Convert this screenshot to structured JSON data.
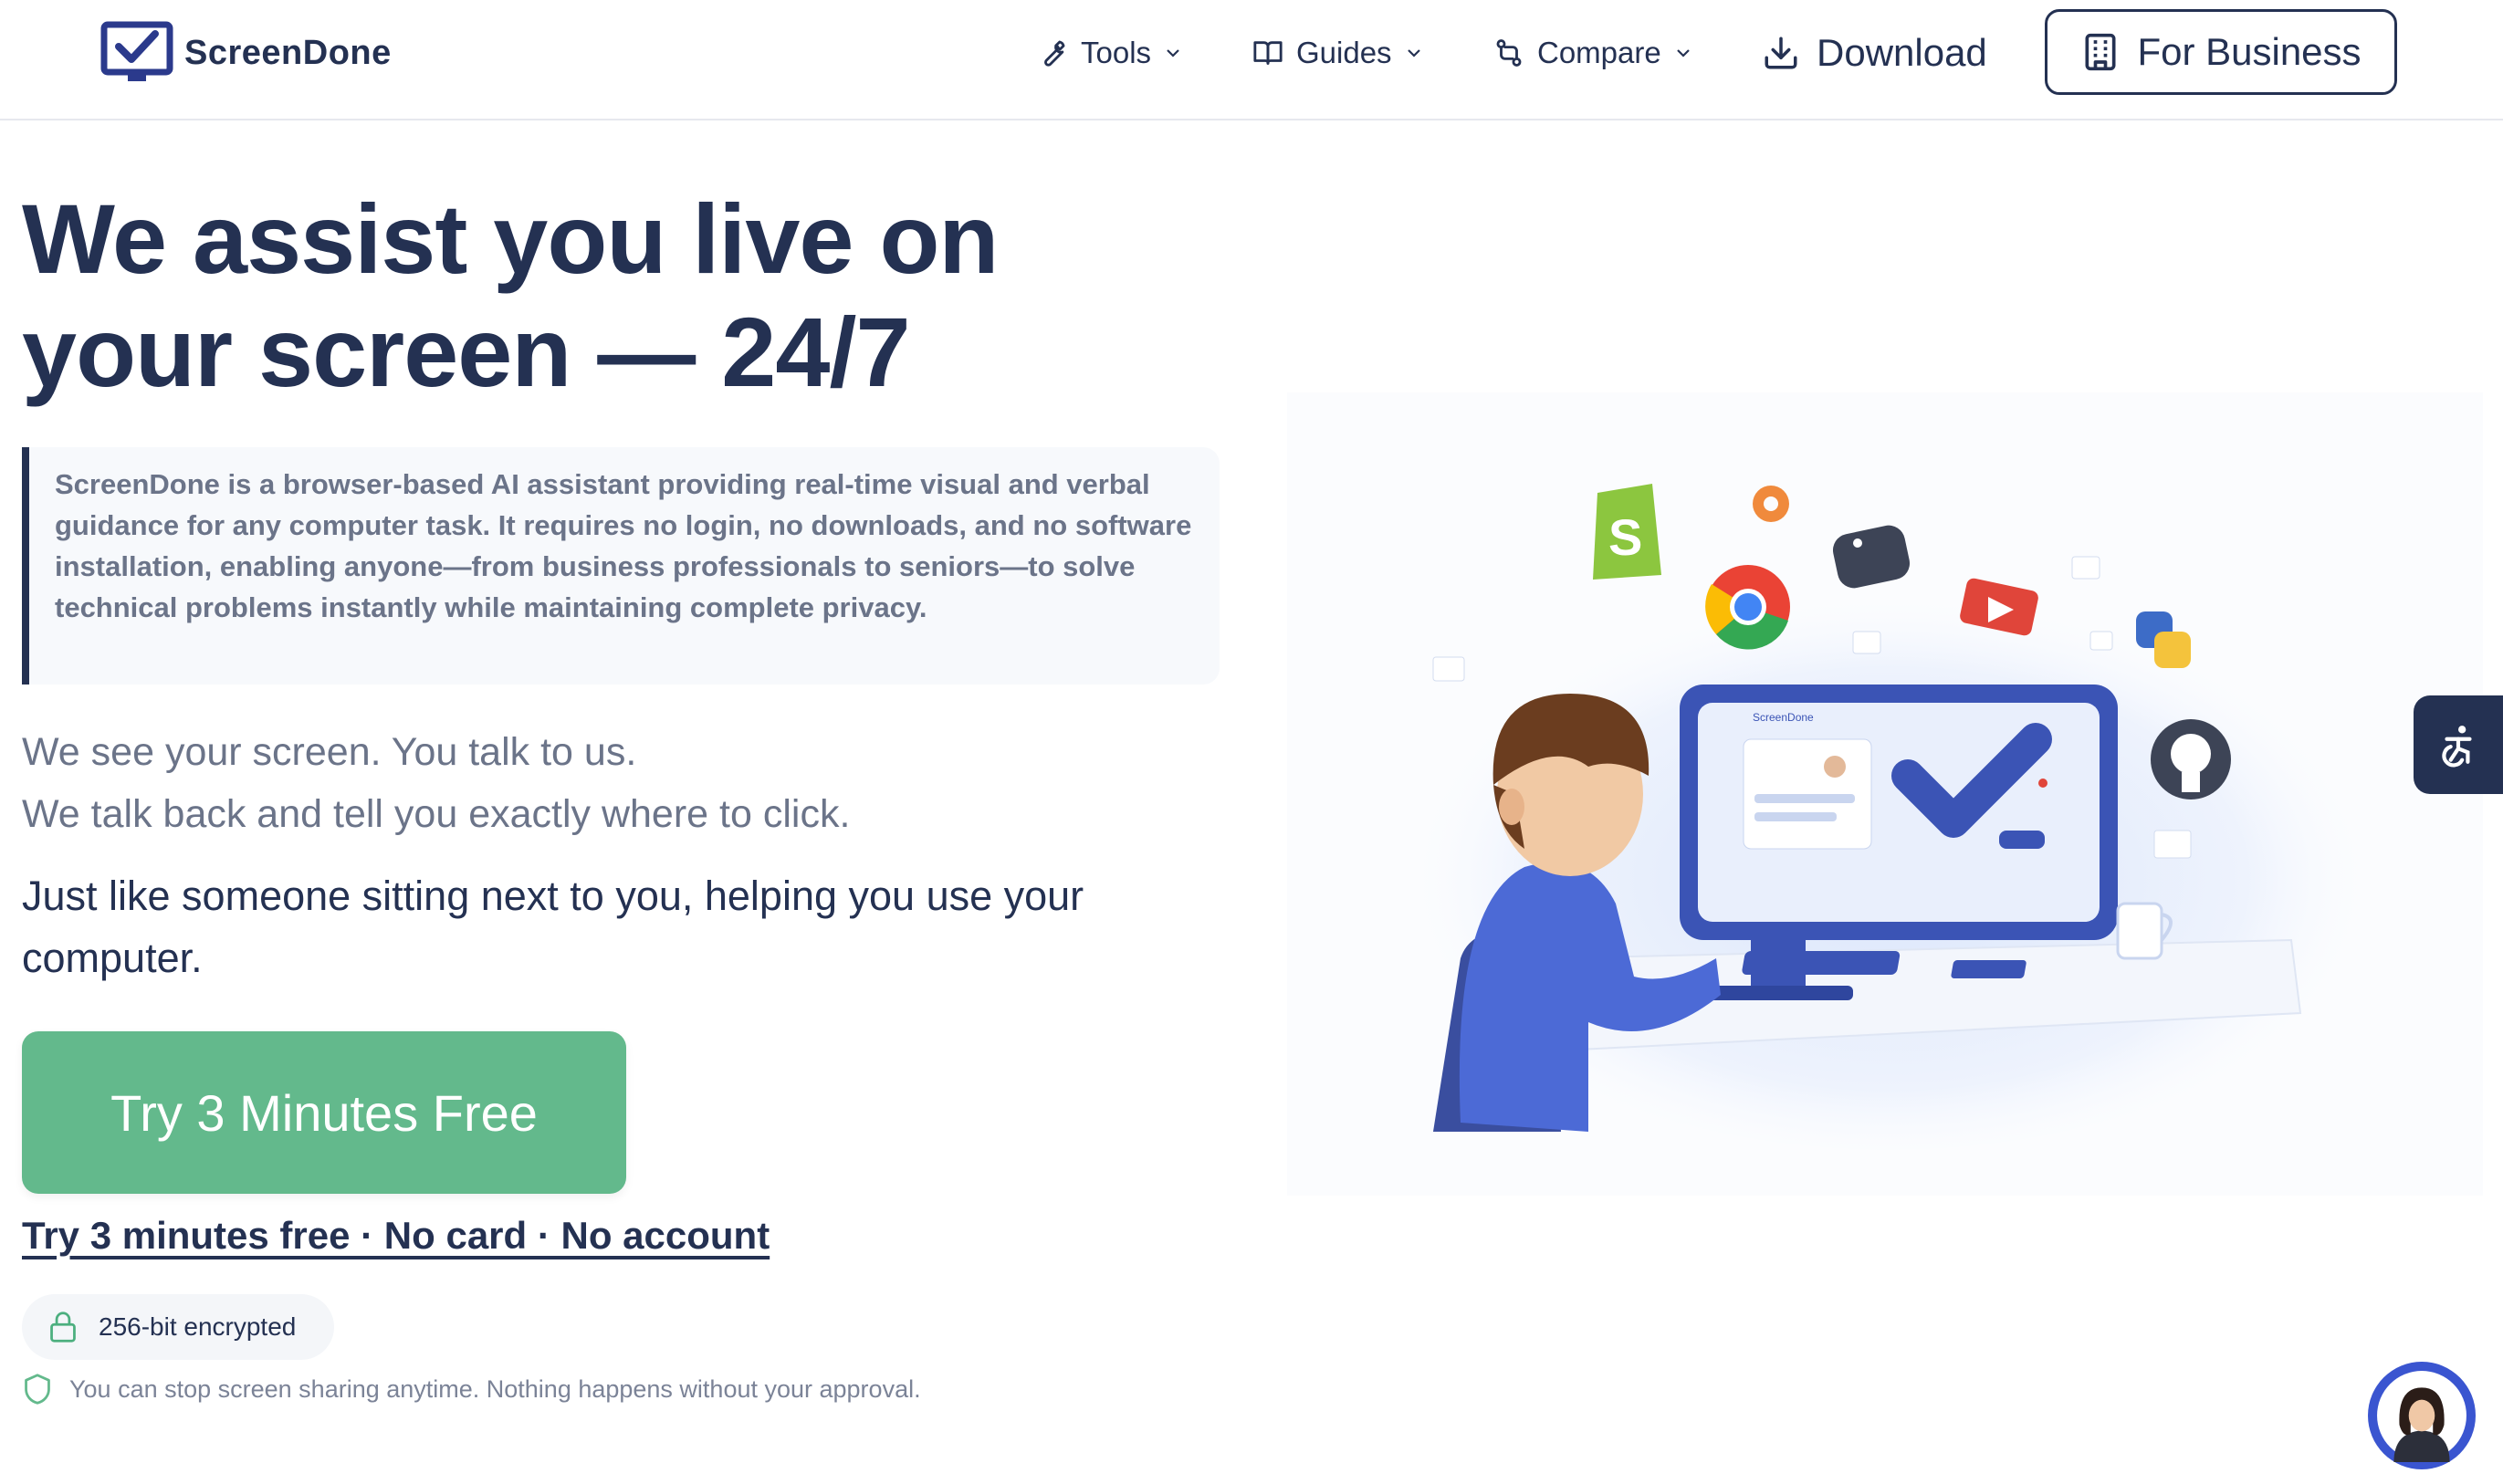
{
  "brand": {
    "name": "ScreenDone",
    "color": "#243152",
    "accent": "#63b98c"
  },
  "nav": {
    "items": [
      {
        "label": "Tools",
        "icon": "wrench-icon"
      },
      {
        "label": "Guides",
        "icon": "book-icon"
      },
      {
        "label": "Compare",
        "icon": "compare-icon"
      }
    ],
    "download_label": "Download",
    "business_label": "For Business"
  },
  "hero": {
    "title_line1": "We assist you live on",
    "title_line2": "your screen — 24/7",
    "description": "ScreenDone is a browser-based AI assistant providing real-time visual and verbal guidance for any computer task. It requires no login, no downloads, and no software installation, enabling anyone—from business professionals to seniors—to solve technical problems instantly while maintaining complete privacy.",
    "lead_line1": "We see your screen. You talk to us.",
    "lead_line2": "We talk back and tell you exactly where to click.",
    "lead2": "Just like someone sitting next to you, helping you use your computer.",
    "cta_label": "Try 3 Minutes Free",
    "cta_link": "Try 3 minutes free · No card · No account",
    "encryption_badge": "256-bit encrypted",
    "privacy_note": "You can stop screen sharing anytime. Nothing happens without your approval."
  },
  "illustration": {
    "screen_brand": "ScreenDone",
    "icons": [
      "shopify-icon",
      "gear-icon",
      "python-icon",
      "chrome-icon",
      "youtube-icon",
      "python-icon",
      "github-icon"
    ]
  },
  "floating": {
    "accessibility_icon": "accessibility-icon",
    "chat_icon": "support-avatar-icon"
  }
}
